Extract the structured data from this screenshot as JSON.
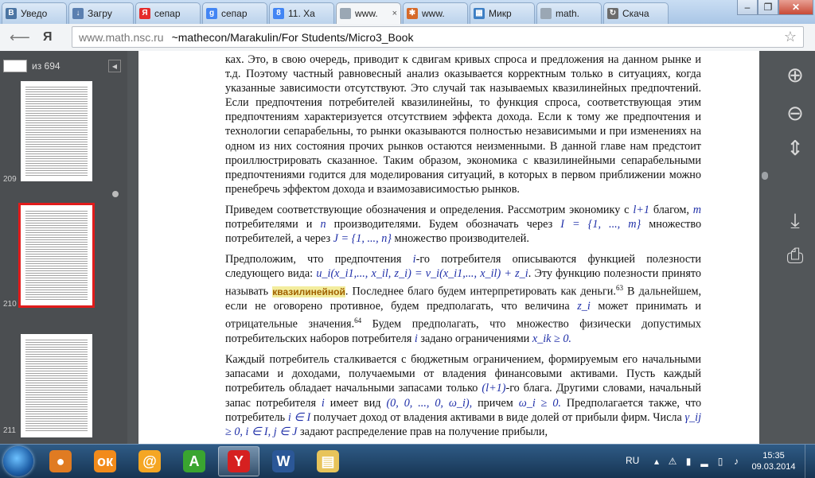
{
  "browser": {
    "tabs": [
      {
        "label": "Уведо",
        "icon": "vk-icon",
        "color": "#4c75a3",
        "glyph": "В"
      },
      {
        "label": "Загру",
        "icon": "download-icon",
        "color": "#5a7fb0",
        "glyph": "↓"
      },
      {
        "label": "сепар",
        "icon": "yandex-icon",
        "color": "#e52b2b",
        "glyph": "Я"
      },
      {
        "label": "сепар",
        "icon": "google-icon",
        "color": "#4285f4",
        "glyph": "g"
      },
      {
        "label": "11. Ха",
        "icon": "google-icon",
        "color": "#4285f4",
        "glyph": "8"
      },
      {
        "label": "www.",
        "icon": "page-icon",
        "color": "#9aa7b4",
        "glyph": "",
        "active": true
      },
      {
        "label": "www.",
        "icon": "colorful-icon",
        "color": "#d66a2a",
        "glyph": "✱"
      },
      {
        "label": "Микр",
        "icon": "windows-icon",
        "color": "#3d7fc4",
        "glyph": "▦"
      },
      {
        "label": "math.",
        "icon": "page-icon",
        "color": "#9aa7b4",
        "glyph": ""
      },
      {
        "label": "Скача",
        "icon": "sync-icon",
        "color": "#6c6c6c",
        "glyph": "↻"
      }
    ],
    "url_host": "www.math.nsc.ru",
    "url_path": "~mathecon/Marakulin/For Students/Micro3_Book"
  },
  "pdf": {
    "page_of": "из 694",
    "thumbnails": [
      {
        "num": "209"
      },
      {
        "num": "210"
      },
      {
        "num": "211"
      }
    ],
    "paragraphs": {
      "p1": "ках. Это, в свою очередь, приводит к сдвигам кривых спроса и предложения на данном рынке и т.д. Поэтому частный равновесный анализ оказывается корректным только в ситуациях, когда указанные зависимости отсутствуют. Это случай так называемых квазилинейных предпочтений. Если предпочтения потребителей квазилинейны, то функция спроса, соответствующая этим предпочтениям характеризуется отсутствием эффекта дохода. Если к тому же предпочтения и технологии сепарабельны, то рынки оказываются полностью независимыми и при изменениях на одном из них состояния прочих рынков остаются неизменными. В данной главе нам предстоит проиллюстрировать сказанное. Таким образом, экономика с квазилинейными сепарабельными предпочтениями годится для моделирования ситуаций, в которых в первом приближении можно пренебречь эффектом дохода и взаимозависимостью рынков.",
      "p2_a": "Приведем соответствующие обозначения и определения. Рассмотрим экономику с",
      "p2_m1": "l+1",
      "p2_b": "благом,",
      "p2_m2": "m",
      "p2_c": "потребителями и",
      "p2_m3": "n",
      "p2_d": "производителями. Будем обозначать через",
      "p2_m4": "I = {1, ..., m}",
      "p2_e": "множество потребителей, а через",
      "p2_m5": "J = {1, ..., n}",
      "p2_f": "множество производителей.",
      "p3_a": "Предположим, что предпочтения",
      "p3_m1": "i",
      "p3_b": "-го потребителя описываются функцией полезности следующего вида:",
      "p3_m2": "u_i(x_i1,..., x_il, z_i) = v_i(x_i1,..., x_il) + z_i",
      "p3_c": ". Эту функцию полезности принято называть",
      "p3_hl": "квазилинейной",
      "p3_d": ". Последнее благо будем интерпретировать как деньги.",
      "p3_fn1": "63",
      "p3_e": "В дальнейшем, если не оговорено противное, будем предполагать, что величина",
      "p3_m3": "z_i",
      "p3_f": "может принимать и отрицательные значения.",
      "p3_fn2": "64",
      "p3_g": "Будем предполагать, что множество физически допустимых потребительских наборов потребителя",
      "p3_m4": "i",
      "p3_h": "задано ограничениями",
      "p3_m5": "x_ik ≥ 0.",
      "p4_a": "Каждый потребитель сталкивается с бюджетным ограничением, формируемым его начальными запасами и доходами, получаемыми от владения финансовыми активами. Пусть каждый потребитель обладает начальными запасами только",
      "p4_m1": "(l+1)",
      "p4_b": "-го блага. Другими словами, начальный запас потребителя",
      "p4_m2": "i",
      "p4_c": "имеет вид",
      "p4_m3": "(0, 0, ..., 0, ω_i),",
      "p4_d": "причем",
      "p4_m4": "ω_i ≥ 0.",
      "p4_e": "Предполагается также, что потребитель",
      "p4_m5": "i ∈ I",
      "p4_f": "получает доход от владения активами в виде долей от прибыли фирм. Числа",
      "p4_m6": "γ_ij ≥ 0, i ∈ I, j ∈ J",
      "p4_g": "задают распределение прав на получение прибыли,"
    }
  },
  "taskbar": {
    "apps": [
      {
        "icon": "colorful-ball-icon",
        "color": "#e07b22",
        "glyph": "●"
      },
      {
        "icon": "odnoklassniki-icon",
        "color": "#f28b1b",
        "glyph": "ок"
      },
      {
        "icon": "mail-agent-icon",
        "color": "#f5a623",
        "glyph": "@"
      },
      {
        "icon": "green-a-icon",
        "color": "#3aa530",
        "glyph": "A"
      },
      {
        "icon": "yandex-browser-icon",
        "color": "#d62020",
        "glyph": "Y",
        "active": true
      },
      {
        "icon": "word-icon",
        "color": "#2b5797",
        "glyph": "W"
      },
      {
        "icon": "explorer-icon",
        "color": "#e8c45a",
        "glyph": "▤"
      }
    ],
    "lang": "RU",
    "time": "15:35",
    "date": "09.03.2014"
  }
}
